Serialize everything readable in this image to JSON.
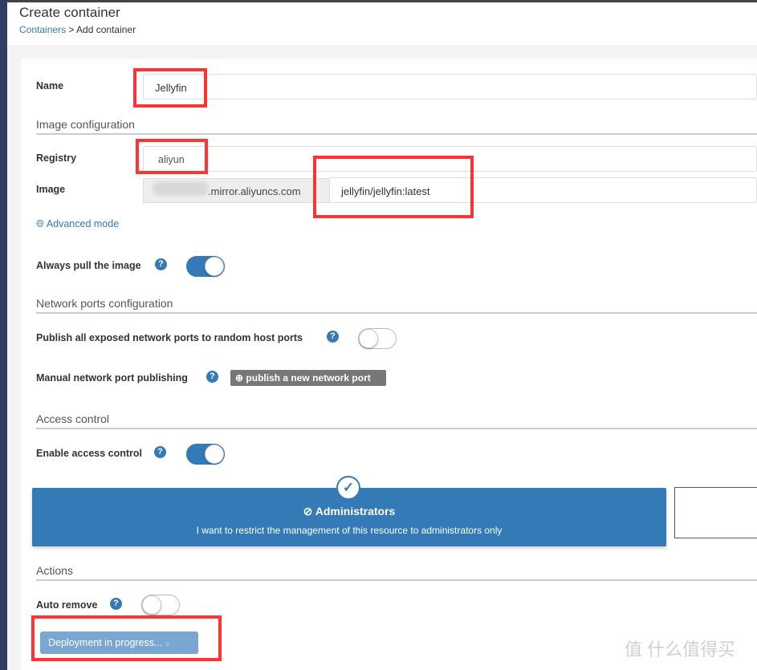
{
  "header": {
    "title": "Create container",
    "breadcrumb_link": "Containers",
    "breadcrumb_sep": " > ",
    "breadcrumb_current": "Add container"
  },
  "form": {
    "name_label": "Name",
    "name_value": "Jellyfin",
    "image_heading": "Image configuration",
    "registry_label": "Registry",
    "registry_value": "aliyun",
    "image_label": "Image",
    "registry_url_suffix": ".mirror.aliyuncs.com",
    "image_value": "jellyfin/jellyfin:latest",
    "advanced_mode": "Advanced mode",
    "always_pull_label": "Always pull the image",
    "always_pull": true,
    "network_heading": "Network ports configuration",
    "publish_all_label": "Publish all exposed network ports to random host ports",
    "publish_all": false,
    "manual_port_label": "Manual network port publishing",
    "publish_button": "publish a new network port",
    "access_heading": "Access control",
    "enable_access_label": "Enable access control",
    "enable_access": true,
    "admin_title": "Administrators",
    "admin_desc": "I want to restrict the management of this resource to administrators only",
    "actions_heading": "Actions",
    "auto_remove_label": "Auto remove",
    "auto_remove": false,
    "deploy_button": "Deployment in progress...",
    "help": "?"
  },
  "watermark": "值 什么值得买",
  "colors": {
    "accent": "#337ab7",
    "annotation": "#ff3333",
    "sidebar": "#2e3f63"
  }
}
